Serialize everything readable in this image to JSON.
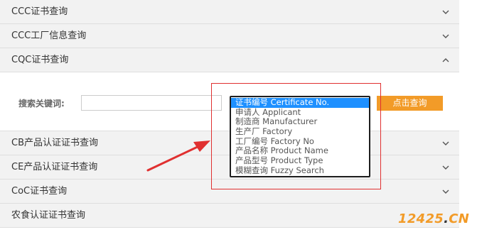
{
  "accordion": {
    "items": [
      {
        "label": "CCC证书查询",
        "state": "collapsed"
      },
      {
        "label": "CCC工厂信息查询",
        "state": "collapsed"
      },
      {
        "label": "CQC证书查询",
        "state": "expanded"
      },
      {
        "label": "CB产品认证证书查询",
        "state": "collapsed"
      },
      {
        "label": "CE产品认证证书查询",
        "state": "collapsed"
      },
      {
        "label": "CoC证书查询",
        "state": "collapsed"
      },
      {
        "label": "农食认证证书查询",
        "state": "collapsed"
      }
    ]
  },
  "search": {
    "label": "搜索关键词:",
    "input_value": "",
    "button_label": "点击查询"
  },
  "select": {
    "selected_index": 0,
    "options": [
      "证书编号 Certificate No.",
      "申请人 Applicant",
      "制造商 Manufacturer",
      "生产厂 Factory",
      "工厂编号 Factory No",
      "产品名称 Product Name",
      "产品型号 Product Type",
      "模糊查询 Fuzzy Search"
    ]
  },
  "watermark": {
    "number": "12425",
    "dot": ".",
    "suffix": "CN"
  },
  "colors": {
    "header_bg": "#f2f2f2",
    "button_bg": "#f29b28",
    "selected_option_bg": "#1e90ff",
    "annotation_red": "#e03030"
  }
}
